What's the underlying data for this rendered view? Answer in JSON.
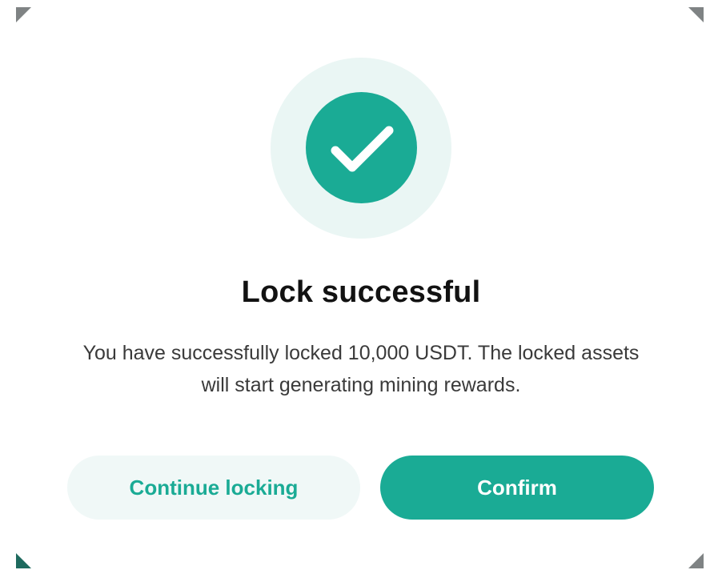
{
  "dialog": {
    "icon": "check-icon",
    "title": "Lock successful",
    "message": "You have successfully locked 10,000 USDT. The locked assets will start generating mining rewards.",
    "buttons": {
      "secondary_label": "Continue locking",
      "primary_label": "Confirm"
    }
  },
  "colors": {
    "accent": "#1aab95",
    "halo": "#eaf6f4",
    "secondary_button_bg": "#f0f8f7",
    "title_text": "#121212",
    "body_text": "#3a3a3a"
  }
}
